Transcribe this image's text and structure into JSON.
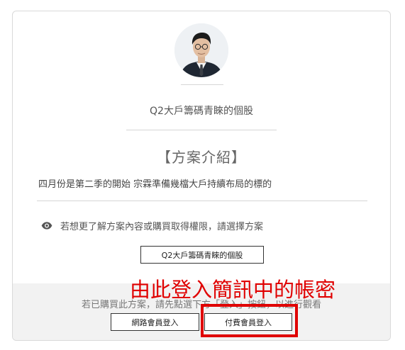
{
  "plan": {
    "title": "Q2大戶籌碼青睞的個股",
    "section_heading": "【方案介紹】",
    "description": "四月份是第二季的開始 宗霖準備幾檔大戶持續布局的標的"
  },
  "hint": {
    "icon": "eye-icon",
    "text": "若想更了解方案內容或購買取得權限，請選擇方案"
  },
  "plan_button_label": "Q2大戶籌碼青睞的個股",
  "login": {
    "note": "若已購買此方案，請先點選下方「登入」按鈕，以進行觀看",
    "web_member_label": "網路會員登入",
    "paid_member_label": "付費會員登入"
  },
  "annotation": {
    "text": "由此登入簡訊中的帳密",
    "color": "#e00000"
  }
}
